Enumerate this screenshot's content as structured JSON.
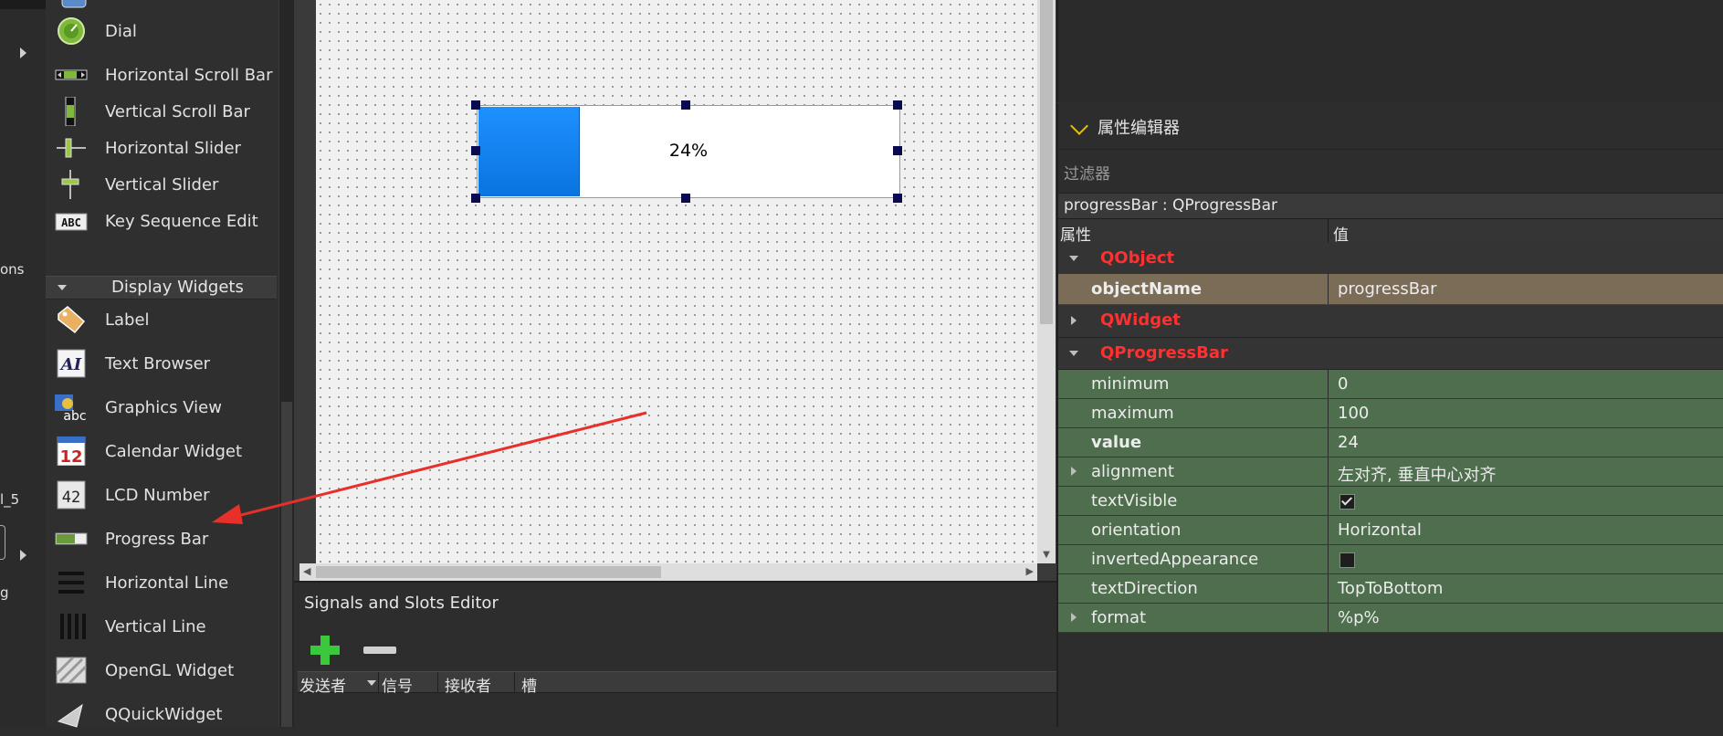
{
  "left_strip": {
    "partial_texts": [
      "ons",
      "l_5",
      "g"
    ]
  },
  "widget_box": {
    "items_top": [
      {
        "label": "Dial",
        "icon": "dial-icon"
      },
      {
        "label": "Horizontal Scroll Bar",
        "icon": "horizontal-scroll-bar-icon"
      },
      {
        "label": "Vertical Scroll Bar",
        "icon": "vertical-scroll-bar-icon"
      },
      {
        "label": "Horizontal Slider",
        "icon": "horizontal-slider-icon"
      },
      {
        "label": "Vertical Slider",
        "icon": "vertical-slider-icon"
      },
      {
        "label": "Key Sequence Edit",
        "icon": "key-sequence-edit-icon"
      }
    ],
    "category": "Display Widgets",
    "items_display": [
      {
        "label": "Label",
        "icon": "label-icon"
      },
      {
        "label": "Text Browser",
        "icon": "text-browser-icon"
      },
      {
        "label": "Graphics View",
        "icon": "graphics-view-icon"
      },
      {
        "label": "Calendar Widget",
        "icon": "calendar-widget-icon"
      },
      {
        "label": "LCD Number",
        "icon": "lcd-number-icon"
      },
      {
        "label": "Progress Bar",
        "icon": "progress-bar-icon"
      },
      {
        "label": "Horizontal Line",
        "icon": "horizontal-line-icon"
      },
      {
        "label": "Vertical Line",
        "icon": "vertical-line-icon"
      },
      {
        "label": "OpenGL Widget",
        "icon": "opengl-widget-icon"
      },
      {
        "label": "QQuickWidget",
        "icon": "qquickwidget-icon"
      }
    ],
    "calendar_icon_number": "12",
    "lcd_icon_text": "42",
    "key_icon_text": "ABC"
  },
  "form": {
    "progress_bar": {
      "value": 24,
      "text": "24%"
    },
    "colors": {
      "fill": "#1e90ff",
      "handles": "#0a0a50",
      "arrow": "#e8302a"
    }
  },
  "signals_slots": {
    "title": "Signals and Slots Editor",
    "columns": [
      "发送者",
      "信号",
      "接收者",
      "槽"
    ]
  },
  "property_editor": {
    "title": "属性编辑器",
    "filter_placeholder": "过滤器",
    "object_line": "progressBar : QProgressBar",
    "col_property": "属性",
    "col_value": "值",
    "groups": {
      "qobject": "QObject",
      "qwidget": "QWidget",
      "qprogressbar": "QProgressBar"
    },
    "object_name": {
      "name": "objectName",
      "value": "progressBar"
    },
    "props": {
      "minimum": {
        "name": "minimum",
        "value": "0"
      },
      "maximum": {
        "name": "maximum",
        "value": "100"
      },
      "value": {
        "name": "value",
        "value": "24"
      },
      "alignment": {
        "name": "alignment",
        "value": "左对齐, 垂直中心对齐"
      },
      "textVisible": {
        "name": "textVisible",
        "checked": true
      },
      "orientation": {
        "name": "orientation",
        "value": "Horizontal"
      },
      "invertedAppearance": {
        "name": "invertedAppearance",
        "checked": false
      },
      "textDirection": {
        "name": "textDirection",
        "value": "TopToBottom"
      },
      "format": {
        "name": "format",
        "value": "%p%"
      }
    }
  }
}
